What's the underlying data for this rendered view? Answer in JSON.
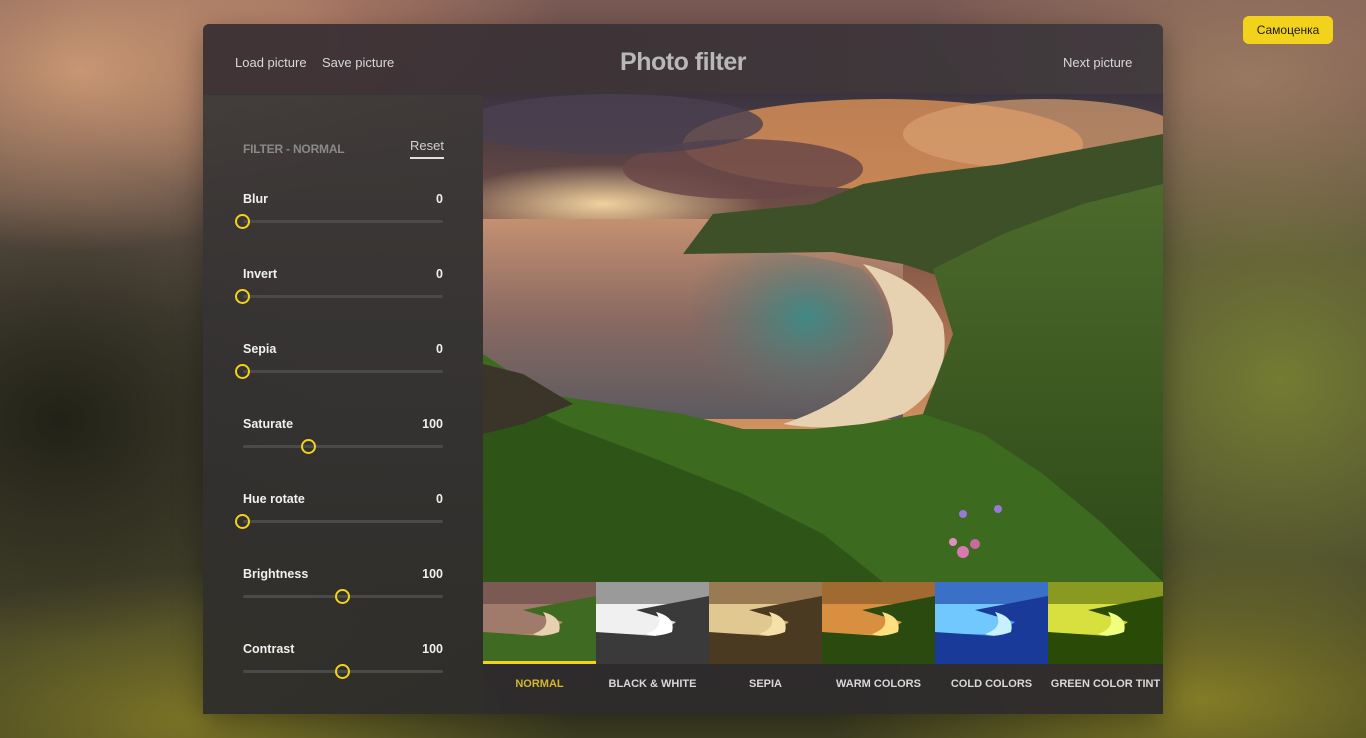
{
  "top_button": "Самоценка",
  "header": {
    "load_label": "Load picture",
    "save_label": "Save picture",
    "title": "Photo filter",
    "next_label": "Next picture"
  },
  "sidebar": {
    "filter_label": "Filter - normal",
    "reset_label": "Reset",
    "sliders": [
      {
        "label": "Blur",
        "value": "0",
        "fraction": 0.0
      },
      {
        "label": "Invert",
        "value": "0",
        "fraction": 0.0
      },
      {
        "label": "Sepia",
        "value": "0",
        "fraction": 0.0
      },
      {
        "label": "Saturate",
        "value": "100",
        "fraction": 0.33
      },
      {
        "label": "Hue rotate",
        "value": "0",
        "fraction": 0.0
      },
      {
        "label": "Brightness",
        "value": "100",
        "fraction": 0.5
      },
      {
        "label": "Contrast",
        "value": "100",
        "fraction": 0.5
      }
    ]
  },
  "filters": [
    {
      "label": "NORMAL",
      "active": true
    },
    {
      "label": "BLACK & WHITE",
      "active": false
    },
    {
      "label": "SEPIA",
      "active": false
    },
    {
      "label": "WARM COLORS",
      "active": false
    },
    {
      "label": "COLD COLORS",
      "active": false
    },
    {
      "label": "GREEN COLOR TINT",
      "active": false
    }
  ],
  "colors": {
    "accent": "#f2d21b"
  }
}
